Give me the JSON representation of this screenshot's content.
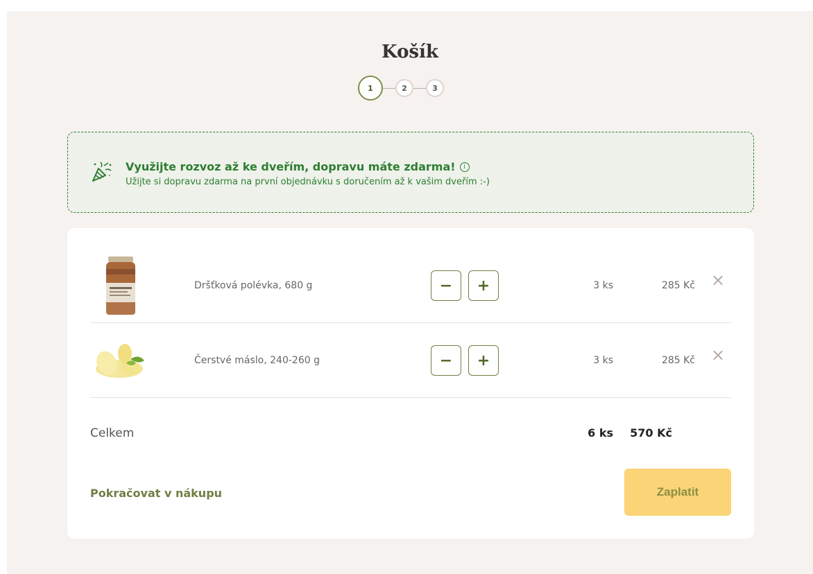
{
  "header": {
    "title": "Košík"
  },
  "steps": [
    {
      "label": "1",
      "state": "active"
    },
    {
      "label": "2",
      "state": "inactive"
    },
    {
      "label": "3",
      "state": "inactive"
    }
  ],
  "promo": {
    "title": "Využijte rozvoz až ke dveřím, dopravu máte zdarma!",
    "subtitle": "Užijte si dopravu zdarma na první objednávku s doručením až k vašim dveřím :-)",
    "icon": "party-popper-icon",
    "info_icon": "info-icon",
    "info_glyph": "i"
  },
  "cart": {
    "items": [
      {
        "name": "Dršťková polévka, 680 g",
        "qty": "3 ks",
        "price": "285 Kč",
        "image": "soup-jar-image"
      },
      {
        "name": "Čerstvé máslo, 240-260 g",
        "qty": "3 ks",
        "price": "285 Kč",
        "image": "butter-image"
      }
    ],
    "minus_glyph": "−",
    "plus_glyph": "+",
    "remove_glyph": "×",
    "total_label": "Celkem",
    "total_qty": "6 ks",
    "total_price": "570 Kč"
  },
  "actions": {
    "continue_label": "Pokračovat v nákupu",
    "pay_label": "Zaplatit"
  },
  "colors": {
    "page_bg": "#f5f2ef",
    "accent_green": "#2e7d32",
    "olive": "#6f7f44",
    "pay_button": "#fad476"
  }
}
